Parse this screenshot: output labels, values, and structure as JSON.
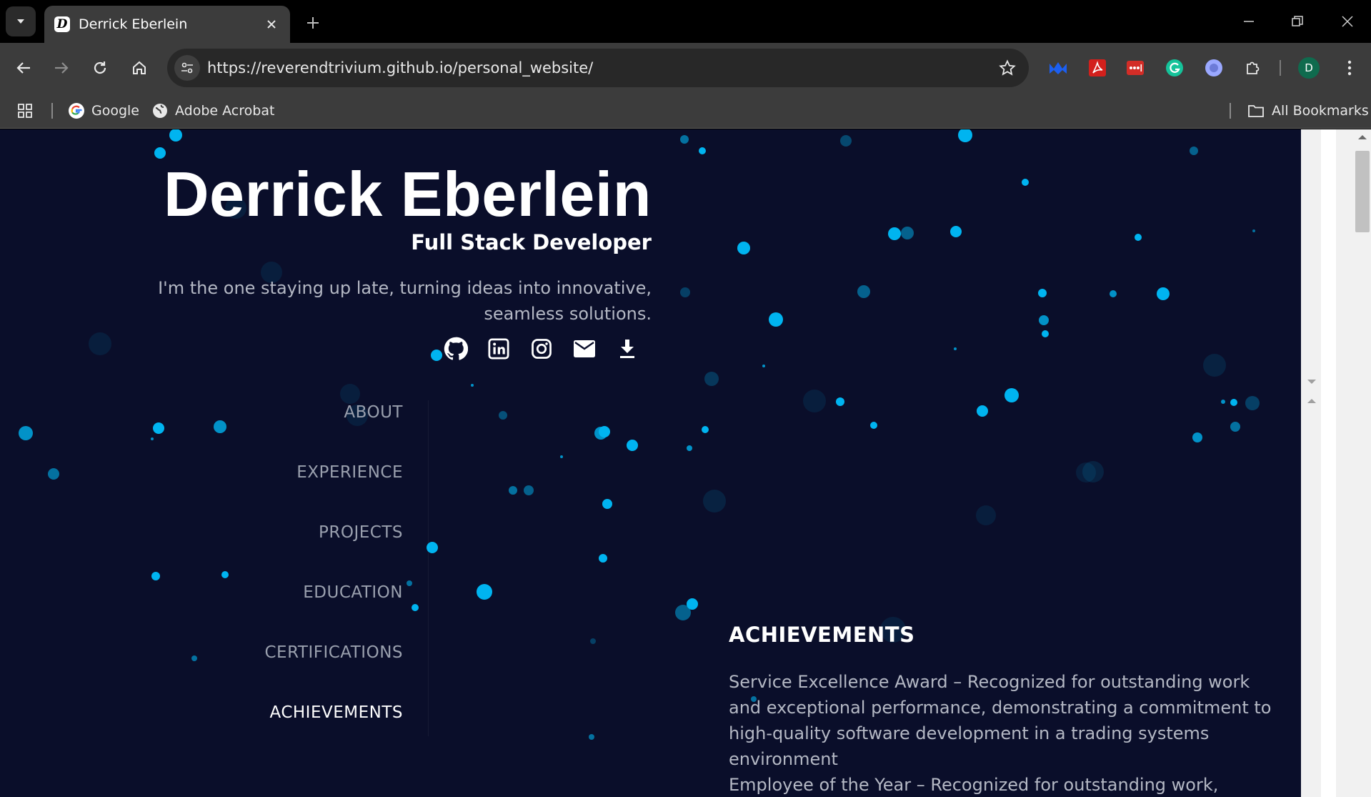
{
  "browser": {
    "tab_title": "Derrick Eberlein",
    "favicon_letter": "D",
    "url": "https://reverendtrivium.github.io/personal_website/",
    "profile_initial": "D",
    "bookmarks": [
      {
        "label": "Google",
        "icon": "google-icon"
      },
      {
        "label": "Adobe Acrobat",
        "icon": "globe-icon"
      }
    ],
    "all_bookmarks_label": "All Bookmarks",
    "extensions": [
      "malwarebytes-icon",
      "acrobat-icon",
      "lastpass-icon",
      "grammarly-icon",
      "gemini-icon",
      "puzzle-icon"
    ]
  },
  "hero": {
    "name": "Derrick Eberlein",
    "role": "Full Stack Developer",
    "tagline": "I'm the one staying up late, turning ideas into innovative, seamless solutions."
  },
  "socials": [
    "github-icon",
    "linkedin-icon",
    "instagram-icon",
    "mail-icon",
    "download-icon"
  ],
  "nav": {
    "items": [
      "ABOUT",
      "EXPERIENCE",
      "PROJECTS",
      "EDUCATION",
      "CERTIFICATIONS",
      "ACHIEVEMENTS"
    ],
    "active": "ACHIEVEMENTS"
  },
  "achievements": {
    "title": "ACHIEVEMENTS",
    "items": [
      "Service Excellence Award – Recognized for outstanding work and exceptional performance, demonstrating a commitment to high-quality software development in a trading systems environment",
      "Employee of the Year – Recognized for outstanding work,"
    ]
  },
  "colors": {
    "page_bg": "#0a0e2a",
    "particle": "#00b4f0",
    "nav_inactive": "#9aa0ae",
    "body_text": "#b4b8c4",
    "chrome_bg": "#3c3c3c"
  }
}
